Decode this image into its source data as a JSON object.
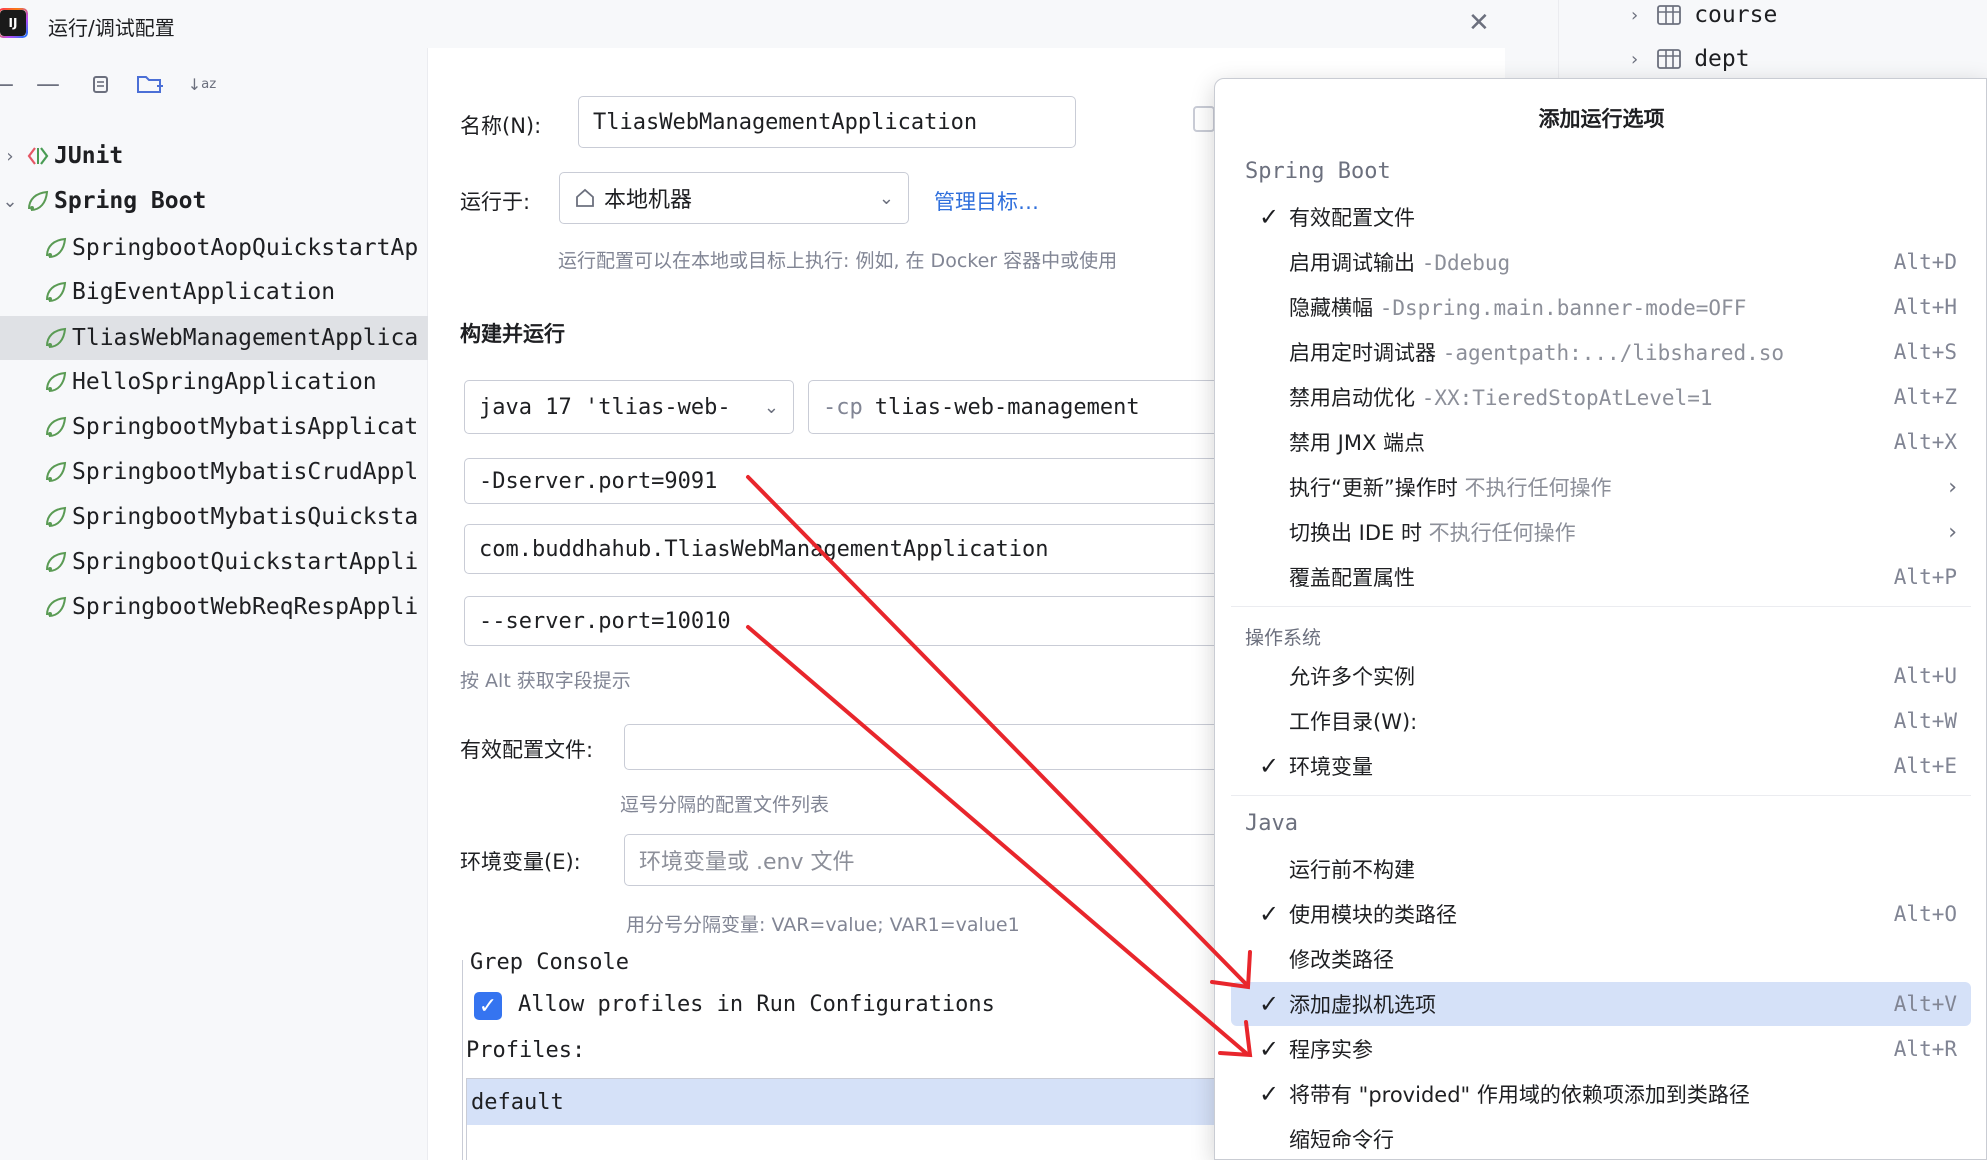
{
  "window": {
    "title": "运行/调试配置"
  },
  "tree": {
    "groups": [
      {
        "label": "JUnit"
      },
      {
        "label": "Spring Boot"
      }
    ],
    "items": [
      {
        "label": "SpringbootAopQuickstartAp"
      },
      {
        "label": "BigEventApplication"
      },
      {
        "label": "TliasWebManagementApplica"
      },
      {
        "label": "HelloSpringApplication"
      },
      {
        "label": "SpringbootMybatisApplicat"
      },
      {
        "label": "SpringbootMybatisCrudAppl"
      },
      {
        "label": "SpringbootMybatisQuicksta"
      },
      {
        "label": "SpringbootQuickstartAppli"
      },
      {
        "label": "SpringbootWebReqRespAppli"
      }
    ]
  },
  "form": {
    "name_label": "名称(N):",
    "name_value": "TliasWebManagementApplication",
    "run_on_label": "运行于:",
    "run_on_value": "本地机器",
    "manage_targets": "管理目标…",
    "run_on_hint": "运行配置可以在本地或目标上执行: 例如, 在 Docker 容器中或使用",
    "build_run_title": "构建并运行",
    "jdk_value": "java 17 'tlias-web-",
    "cp_prefix": "-cp",
    "cp_value": "tlias-web-management",
    "vm_options": "-Dserver.port=9091",
    "main_class": "com.buddhahub.TliasWebManagementApplication",
    "program_args": "--server.port=10010",
    "alt_hint": "按 Alt 获取字段提示",
    "profiles_label": "有效配置文件:",
    "profiles_hint": "逗号分隔的配置文件列表",
    "env_label": "环境变量(E):",
    "env_placeholder": "环境变量或 .env 文件",
    "env_hint": "用分号分隔变量: VAR=value; VAR1=value1",
    "grep_title": "Grep Console",
    "allow_profiles": "Allow profiles in Run Configurations",
    "profiles_list_label": "Profiles:",
    "profile_default": "default"
  },
  "db_tree": {
    "items": [
      {
        "label": "course"
      },
      {
        "label": "dept"
      }
    ]
  },
  "popup": {
    "title": "添加运行选项",
    "sections": {
      "spring_boot": "Spring Boot",
      "os": "操作系统",
      "java": "Java"
    },
    "spring_items": [
      {
        "label": "有效配置文件",
        "opt": "",
        "shortcut": ""
      },
      {
        "label": "启用调试输出",
        "opt": "-Ddebug",
        "shortcut": "Alt+D"
      },
      {
        "label": "隐藏横幅",
        "opt": "-Dspring.main.banner-mode=OFF",
        "shortcut": "Alt+H"
      },
      {
        "label": "启用定时调试器",
        "opt": "-agentpath:.../libshared.so",
        "shortcut": "Alt+S"
      },
      {
        "label": "禁用启动优化",
        "opt": "-XX:TieredStopAtLevel=1",
        "shortcut": "Alt+Z"
      },
      {
        "label": "禁用 JMX 端点",
        "opt": "",
        "shortcut": "Alt+X"
      },
      {
        "label": "执行“更新”操作时",
        "opt": "不执行任何操作",
        "shortcut": ""
      },
      {
        "label": "切换出 IDE 时",
        "opt": "不执行任何操作",
        "shortcut": ""
      },
      {
        "label": "覆盖配置属性",
        "opt": "",
        "shortcut": "Alt+P"
      }
    ],
    "os_items": [
      {
        "label": "允许多个实例",
        "shortcut": "Alt+U"
      },
      {
        "label": "工作目录(W):",
        "shortcut": "Alt+W"
      },
      {
        "label": "环境变量",
        "shortcut": "Alt+E"
      }
    ],
    "java_items": [
      {
        "label": "运行前不构建",
        "shortcut": ""
      },
      {
        "label": "使用模块的类路径",
        "shortcut": "Alt+O"
      },
      {
        "label": "修改类路径",
        "shortcut": ""
      },
      {
        "label": "添加虚拟机选项",
        "shortcut": "Alt+V"
      },
      {
        "label": "程序实参",
        "shortcut": "Alt+R"
      },
      {
        "label": "将带有 \"provided\" 作用域的依赖项添加到类路径",
        "shortcut": ""
      },
      {
        "label": "缩短命令行",
        "shortcut": ""
      }
    ]
  },
  "icons": {
    "check": "check-icon",
    "submenu": "chevron-right-icon",
    "home": "home-icon",
    "table": "table-icon",
    "spring": "spring-boot-icon"
  },
  "colors": {
    "accent": "#3574f0",
    "selection": "#d5e1f8",
    "arrow": "#e8262c",
    "link": "#2f6fdc"
  }
}
